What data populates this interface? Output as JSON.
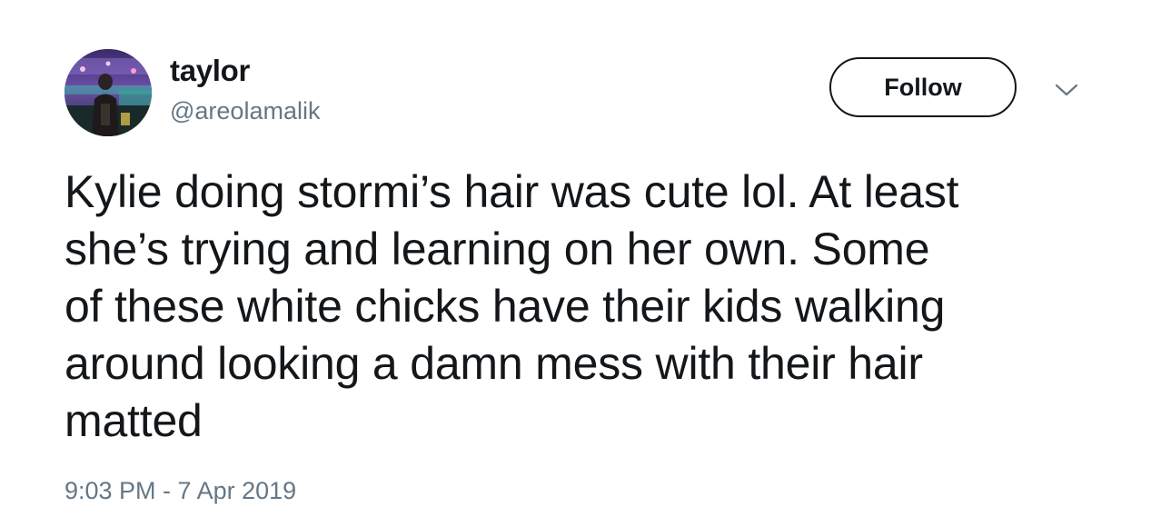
{
  "author": {
    "display_name": "taylor",
    "handle": "@areolamalik",
    "avatar_icon": "profile-photo-avatar"
  },
  "follow_button": {
    "label": "Follow"
  },
  "menu": {
    "icon": "chevron-down-icon"
  },
  "tweet": {
    "text": "Kylie doing stormi’s hair was cute lol. At least\nshe’s trying and learning on her own. Some\nof these white chicks have their kids walking\naround looking a damn mess with their hair\nmatted",
    "timestamp": "9:03 PM - 7 Apr 2019"
  },
  "colors": {
    "text_primary": "#14171a",
    "text_secondary": "#657786",
    "background": "#ffffff"
  }
}
